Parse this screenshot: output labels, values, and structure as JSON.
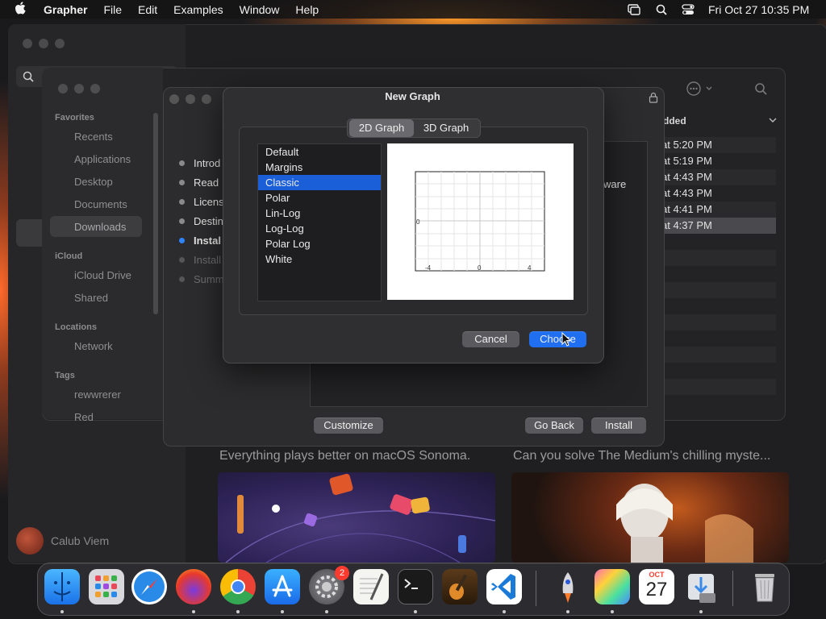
{
  "menubar": {
    "app": "Grapher",
    "items": [
      "File",
      "Edit",
      "Examples",
      "Window",
      "Help"
    ],
    "clock": "Fri Oct 27  10:35 PM"
  },
  "finder": {
    "favorites_head": "Favorites",
    "favorites": [
      "Recents",
      "Applications",
      "Desktop",
      "Documents",
      "Downloads"
    ],
    "icloud_head": "iCloud",
    "icloud": [
      "iCloud Drive",
      "Shared"
    ],
    "locations_head": "Locations",
    "locations": [
      "Network"
    ],
    "tags_head": "Tags",
    "tags": [
      "rewwrerer",
      "Red"
    ],
    "column_header": "dded",
    "rows": [
      "at 5:20 PM",
      "at 5:19 PM",
      "at 4:43 PM",
      "at 4:43 PM",
      "at 4:41 PM",
      "at 4:37 PM"
    ]
  },
  "installer": {
    "steps": [
      "Introd",
      "Read",
      "Licens",
      "Destin",
      "Instal",
      "Install",
      "Summ"
    ],
    "body_fragment": "ware",
    "customize": "Customize",
    "go_back": "Go Back",
    "install": "Install"
  },
  "dialog": {
    "title": "New Graph",
    "tabs": [
      "2D Graph",
      "3D Graph"
    ],
    "templates": [
      "Default",
      "Margins",
      "Classic",
      "Polar",
      "Lin-Log",
      "Log-Log",
      "Polar Log",
      "White"
    ],
    "selected_template": "Classic",
    "preview_labels": {
      "y_zero": "0",
      "x_left": "-4",
      "x_mid": "0",
      "x_right": "4"
    },
    "cancel": "Cancel",
    "choose": "Choose"
  },
  "store": {
    "banner1": "Everything plays better on macOS Sonoma.",
    "banner2": "Can you solve The Medium's chilling myste...",
    "user": "Calub Viem"
  },
  "dock": {
    "settings_badge": "2",
    "calendar_month": "OCT",
    "calendar_day": "27"
  }
}
